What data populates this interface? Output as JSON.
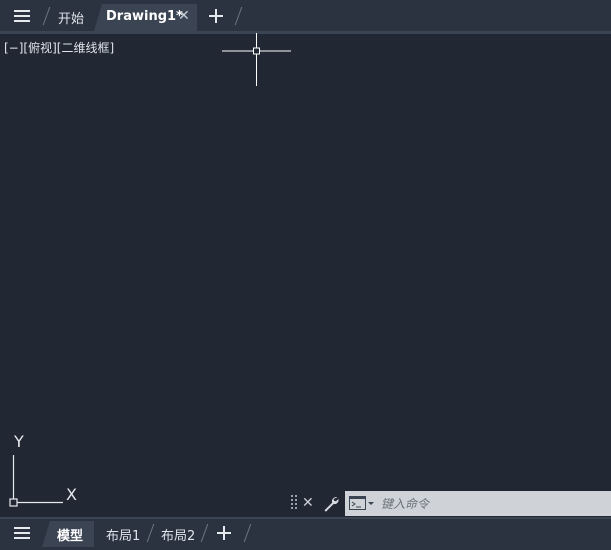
{
  "top_tabs": {
    "menu_icon": "hamburger-menu-icon",
    "start_label": "开始",
    "active_label": "Drawing1*",
    "close_icon": "close-icon",
    "add_icon": "plus-icon"
  },
  "viewport": {
    "label": "[−][俯视][二维线框]",
    "ucs_y_label": "Y",
    "ucs_x_label": "X"
  },
  "command_line": {
    "placeholder": "键入命令",
    "icons": [
      "grip-icon",
      "close-icon",
      "wrench-icon",
      "command-prompt-icon"
    ]
  },
  "layout_tabs": {
    "menu_icon": "hamburger-menu-icon",
    "tabs": [
      {
        "label": "模型",
        "active": true
      },
      {
        "label": "布局1",
        "active": false
      },
      {
        "label": "布局2",
        "active": false
      }
    ],
    "add_icon": "plus-icon"
  },
  "colors": {
    "background": "#212833",
    "bar": "#2b3340",
    "active_tab": "#3b4453",
    "command_input": "#cfd2d6"
  }
}
